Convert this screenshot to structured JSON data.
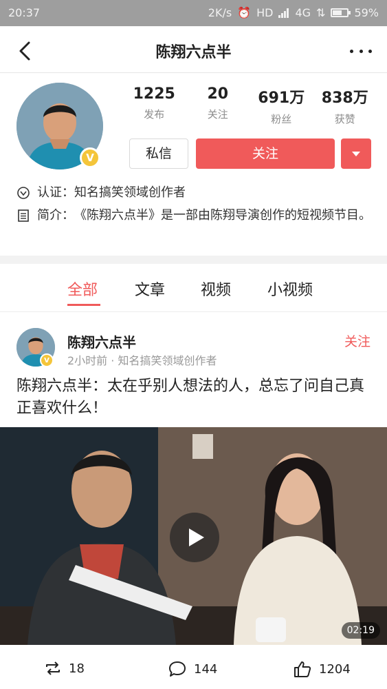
{
  "status_bar": {
    "time": "20:37",
    "net_speed": "2K/s",
    "hd": "HD",
    "network": "4G",
    "battery": "59%"
  },
  "nav": {
    "title": "陈翔六点半",
    "back_icon": "back-arrow-icon",
    "more_icon": "more-dots-icon"
  },
  "profile": {
    "stats": [
      {
        "value": "1225",
        "label": "发布"
      },
      {
        "value": "20",
        "label": "关注"
      },
      {
        "value": "691万",
        "label": "粉丝"
      },
      {
        "value": "838万",
        "label": "获赞"
      }
    ],
    "message_label": "私信",
    "follow_label": "关注",
    "verify_label": "认证：",
    "verify_text": "知名搞笑领域创作者",
    "intro_label": "简介：",
    "intro_text": "《陈翔六点半》是一部由陈翔导演创作的短视频节目。",
    "badge": "V"
  },
  "tabs": [
    {
      "label": "全部",
      "active": true
    },
    {
      "label": "文章",
      "active": false
    },
    {
      "label": "视频",
      "active": false
    },
    {
      "label": "小视频",
      "active": false
    }
  ],
  "post": {
    "author": "陈翔六点半",
    "meta": "2小时前 · 知名搞笑领域创作者",
    "follow_label": "关注",
    "title": "陈翔六点半：太在乎别人想法的人，总忘了问自己真正喜欢什么！",
    "duration": "02:19",
    "reposts": "18",
    "comments": "144",
    "likes": "1204"
  },
  "colors": {
    "accent": "#f05a5a",
    "badge": "#f4c53a",
    "statusbar": "#9e9e9e"
  }
}
